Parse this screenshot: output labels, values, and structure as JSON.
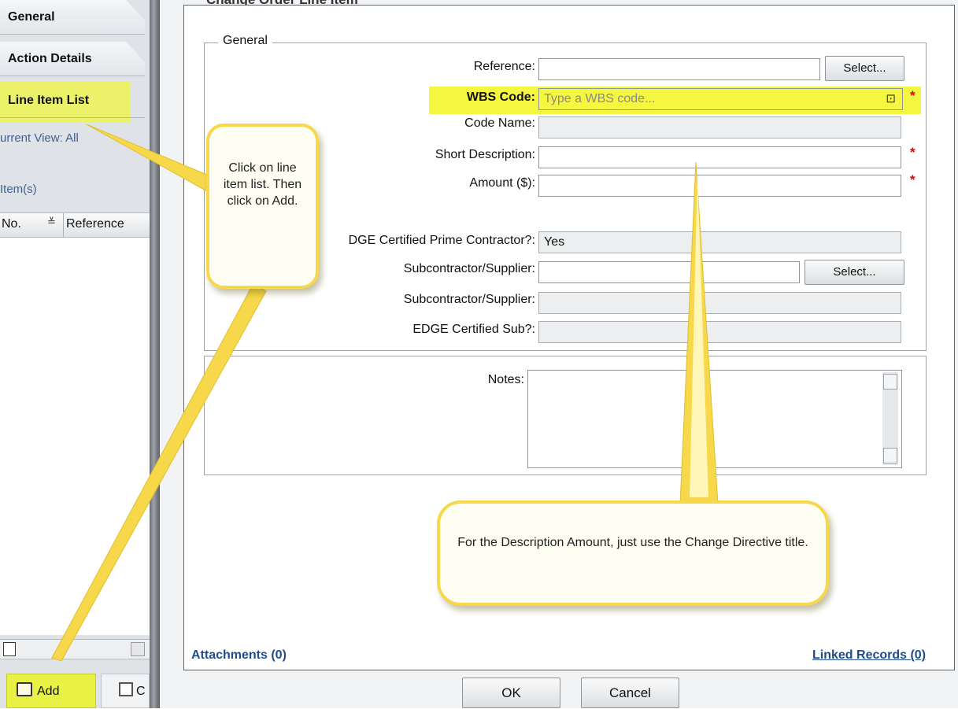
{
  "sidebar": {
    "tabs": [
      {
        "label": "General"
      },
      {
        "label": "Action Details"
      },
      {
        "label": "Line Item List"
      }
    ],
    "current_view": "urrent View: All",
    "item_count": "Item(s)",
    "columns": [
      "No.",
      "Reference"
    ],
    "add_label": "Add",
    "copy_label": "C"
  },
  "dialog": {
    "title": "Change Order Line Item",
    "section_general": "General",
    "fields": {
      "reference": {
        "label": "Reference:",
        "value": ""
      },
      "wbs_code": {
        "label": "WBS Code:",
        "placeholder": "Type a WBS code..."
      },
      "code_name": {
        "label": "Code Name:"
      },
      "short_description": {
        "label": "Short Description:"
      },
      "amount": {
        "label": "Amount ($):"
      },
      "edge_prime": {
        "label": "DGE Certified Prime Contractor?:",
        "value": "Yes"
      },
      "subcontractor_1": {
        "label": "Subcontractor/Supplier:"
      },
      "subcontractor_2": {
        "label": "Subcontractor/Supplier:"
      },
      "edge_sub": {
        "label": "EDGE Certified Sub?:"
      },
      "notes": {
        "label": "Notes:"
      }
    },
    "select_label": "Select...",
    "required_mark": "*",
    "attachments": "Attachments (0)",
    "linked_records": "Linked Records (0)",
    "ok": "OK",
    "cancel": "Cancel"
  },
  "callouts": {
    "line_item": "Click on line item list. Then click on Add.",
    "description": "For the Description Amount, just use the Change Directive title."
  },
  "colors": {
    "highlight": "#f5f63f",
    "callout_border": "#f7d84a",
    "link": "#1f4d8c",
    "required": "#d20a0a"
  }
}
